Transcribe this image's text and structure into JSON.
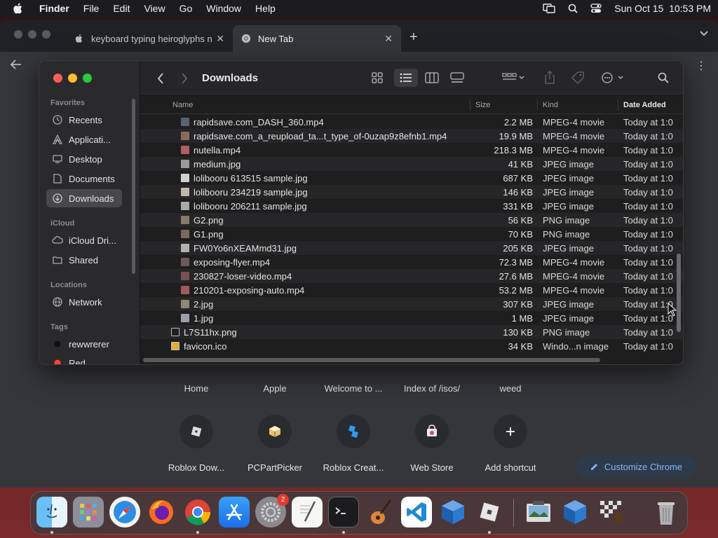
{
  "menubar": {
    "app": "Finder",
    "items": [
      "File",
      "Edit",
      "View",
      "Go",
      "Window",
      "Help"
    ],
    "datetime": "Sun Oct 15  10:53 PM"
  },
  "chrome": {
    "tabs": [
      {
        "title": "keyboard typing heiroglyphs n",
        "icon": "apple-icon"
      },
      {
        "title": "New Tab",
        "icon": "chrome-icon"
      }
    ],
    "shortcuts_row1": [
      "Home",
      "Apple",
      "Welcome to ...",
      "Index of /isos/",
      "weed"
    ],
    "shortcuts_row2": [
      "Roblox Dow...",
      "PCPartPicker",
      "Roblox Creat...",
      "Web Store",
      "Add shortcut"
    ],
    "customize_label": "Customize Chrome"
  },
  "finder": {
    "title": "Downloads",
    "sidebar": {
      "favorites_label": "Favorites",
      "favorites": [
        "Recents",
        "Applicati...",
        "Desktop",
        "Documents",
        "Downloads"
      ],
      "icloud_label": "iCloud",
      "icloud": [
        "iCloud Dri...",
        "Shared"
      ],
      "locations_label": "Locations",
      "locations": [
        "Network"
      ],
      "tags_label": "Tags",
      "tags": [
        "rewwrerer",
        "Red"
      ]
    },
    "columns": {
      "name": "Name",
      "size": "Size",
      "kind": "Kind",
      "date": "Date Added"
    },
    "files": [
      {
        "name": "rapidsave.com_DASH_360.mp4",
        "size": "2.2 MB",
        "kind": "MPEG-4 movie",
        "date": "Today at 1:0",
        "indent": 1,
        "color": "#5c6370"
      },
      {
        "name": "rapidsave.com_a_reupload_ta...t_type_of-0uzap9z8efnb1.mp4",
        "size": "19.9 MB",
        "kind": "MPEG-4 movie",
        "date": "Today at 1:0",
        "indent": 1,
        "color": "#8a6a5a"
      },
      {
        "name": "nutella.mp4",
        "size": "218.3 MB",
        "kind": "MPEG-4 movie",
        "date": "Today at 1:0",
        "indent": 1,
        "color": "#b06060"
      },
      {
        "name": "medium.jpg",
        "size": "41 KB",
        "kind": "JPEG image",
        "date": "Today at 1:0",
        "indent": 1,
        "color": "#9a9a9a"
      },
      {
        "name": "lolibooru 613515 sample.jpg",
        "size": "687 KB",
        "kind": "JPEG image",
        "date": "Today at 1:0",
        "indent": 1,
        "color": "#d0d0d0"
      },
      {
        "name": "lolibooru 234219 sample.jpg",
        "size": "146 KB",
        "kind": "JPEG image",
        "date": "Today at 1:0",
        "indent": 1,
        "color": "#c0b8a8"
      },
      {
        "name": "lolibooru 206211 sample.jpg",
        "size": "331 KB",
        "kind": "JPEG image",
        "date": "Today at 1:0",
        "indent": 1,
        "color": "#a8a8a8"
      },
      {
        "name": "G2.png",
        "size": "56 KB",
        "kind": "PNG image",
        "date": "Today at 1:0",
        "indent": 1,
        "color": "#8a7a6a"
      },
      {
        "name": "G1.png",
        "size": "70 KB",
        "kind": "PNG image",
        "date": "Today at 1:0",
        "indent": 1,
        "color": "#7a6a5a"
      },
      {
        "name": "FW0Yo6nXEAMmd31.jpg",
        "size": "205 KB",
        "kind": "JPEG image",
        "date": "Today at 1:0",
        "indent": 1,
        "color": "#b0b0b0"
      },
      {
        "name": "exposing-flyer.mp4",
        "size": "72.3 MB",
        "kind": "MPEG-4 movie",
        "date": "Today at 1:0",
        "indent": 1,
        "color": "#6a5a5a"
      },
      {
        "name": "230827-loser-video.mp4",
        "size": "27.6 MB",
        "kind": "MPEG-4 movie",
        "date": "Today at 1:0",
        "indent": 1,
        "color": "#7a5050"
      },
      {
        "name": "210201-exposing-auto.mp4",
        "size": "53.2 MB",
        "kind": "MPEG-4 movie",
        "date": "Today at 1:0",
        "indent": 1,
        "color": "#a05a5a"
      },
      {
        "name": "2.jpg",
        "size": "307 KB",
        "kind": "JPEG image",
        "date": "Today at 1:0",
        "indent": 1,
        "color": "#8a8a70"
      },
      {
        "name": "1.jpg",
        "size": "1 MB",
        "kind": "JPEG image",
        "date": "Today at 1:0",
        "indent": 1,
        "color": "#9aa0a8"
      },
      {
        "name": "L7S11hx.png",
        "size": "130 KB",
        "kind": "PNG image",
        "date": "Today at 1:0",
        "indent": 0,
        "color": "#1e1e1e"
      },
      {
        "name": "favicon.ico",
        "size": "34 KB",
        "kind": "Windo...n image",
        "date": "Today at 1:0",
        "indent": 0,
        "color": "#e0b030"
      }
    ]
  },
  "dock": {
    "apps": [
      "finder-icon",
      "launchpad-icon",
      "safari-icon",
      "firefox-icon",
      "chrome-icon",
      "app-store-icon",
      "system-settings-icon",
      "textedit-icon",
      "terminal-icon",
      "garageband-icon",
      "vscode-icon",
      "virtualbox-icon",
      "roblox-icon",
      "preview-icon",
      "virtualbox-vm-icon",
      "chess-icon",
      "trash-icon"
    ],
    "settings_badge": "2"
  },
  "colors": {
    "accent": "#8ab4f8",
    "selected": "#48484a",
    "red": "#ff5f57",
    "yellow": "#febc2e",
    "green": "#28c840"
  }
}
